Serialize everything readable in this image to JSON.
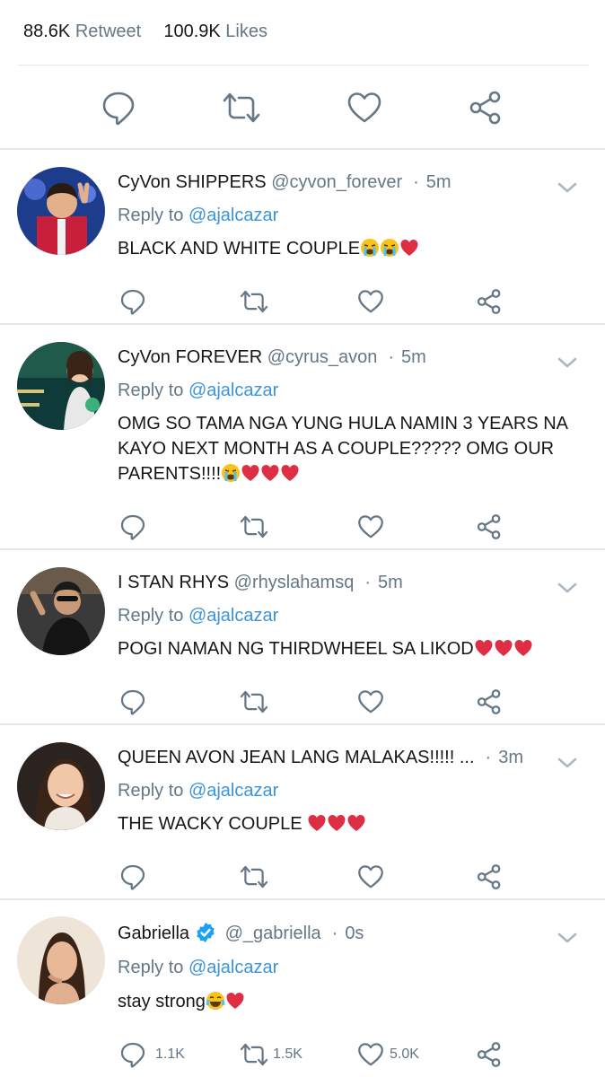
{
  "stats": {
    "retweets_count": "88.6K",
    "retweets_label": "Retweet",
    "likes_count": "100.9K",
    "likes_label": "Likes"
  },
  "main_actions": [
    {
      "icon": "reply-icon"
    },
    {
      "icon": "retweet-icon"
    },
    {
      "icon": "like-icon"
    },
    {
      "icon": "share-icon"
    }
  ],
  "colors": {
    "text": "#14171a",
    "muted": "#657786",
    "link": "#3b94d9",
    "divider": "#e1e8ed",
    "heart": "#e0245e",
    "verified": "#1da1f2"
  },
  "replies": [
    {
      "name": "CyVon SHIPPERS",
      "handle": "@cyvon_forever",
      "dot": "·",
      "time": "5m",
      "reply_prefix": "Reply to",
      "reply_to": "@ajalcazar",
      "text": "BLACK AND WHITE COUPLE",
      "emojis": [
        "crying-face",
        "crying-face",
        "red-heart"
      ],
      "counts": {
        "reply": "",
        "retweet": "",
        "like": ""
      }
    },
    {
      "name": "CyVon FOREVER",
      "handle": "@cyrus_avon",
      "dot": "·",
      "time": "5m",
      "reply_prefix": "Reply to",
      "reply_to": "@ajalcazar",
      "text": "OMG SO TAMA NGA YUNG HULA NAMIN 3 YEARS NA KAYO NEXT MONTH AS A COUPLE????? OMG OUR PARENTS!!!!",
      "emojis": [
        "crying-face",
        "red-heart",
        "red-heart",
        "red-heart"
      ],
      "counts": {
        "reply": "",
        "retweet": "",
        "like": ""
      }
    },
    {
      "name": "I STAN RHYS",
      "handle": "@rhyslahamsq",
      "dot": "·",
      "time": "5m",
      "reply_prefix": "Reply to",
      "reply_to": "@ajalcazar",
      "text": "POGI NAMAN NG THIRDWHEEL SA LIKOD",
      "emojis": [
        "red-heart",
        "red-heart",
        "red-heart"
      ],
      "counts": {
        "reply": "",
        "retweet": "",
        "like": ""
      }
    },
    {
      "name": "QUEEN AVON JEAN LANG MALAKAS!!!!! ...",
      "handle": "",
      "dot": "·",
      "time": "3m",
      "reply_prefix": "Reply to",
      "reply_to": "@ajalcazar",
      "text": "THE WACKY COUPLE ",
      "emojis": [
        "red-heart",
        "red-heart",
        "red-heart"
      ],
      "counts": {
        "reply": "",
        "retweet": "",
        "like": ""
      }
    },
    {
      "name": "Gabriella",
      "handle": "@_gabriella",
      "dot": "·",
      "time": "0s",
      "reply_prefix": "Reply to",
      "reply_to": "@ajalcazar",
      "text": "stay strong",
      "emojis": [
        "laughing-face",
        "red-heart"
      ],
      "counts": {
        "reply": "1.1K",
        "retweet": "1.5K",
        "like": "5.0K"
      }
    }
  ]
}
